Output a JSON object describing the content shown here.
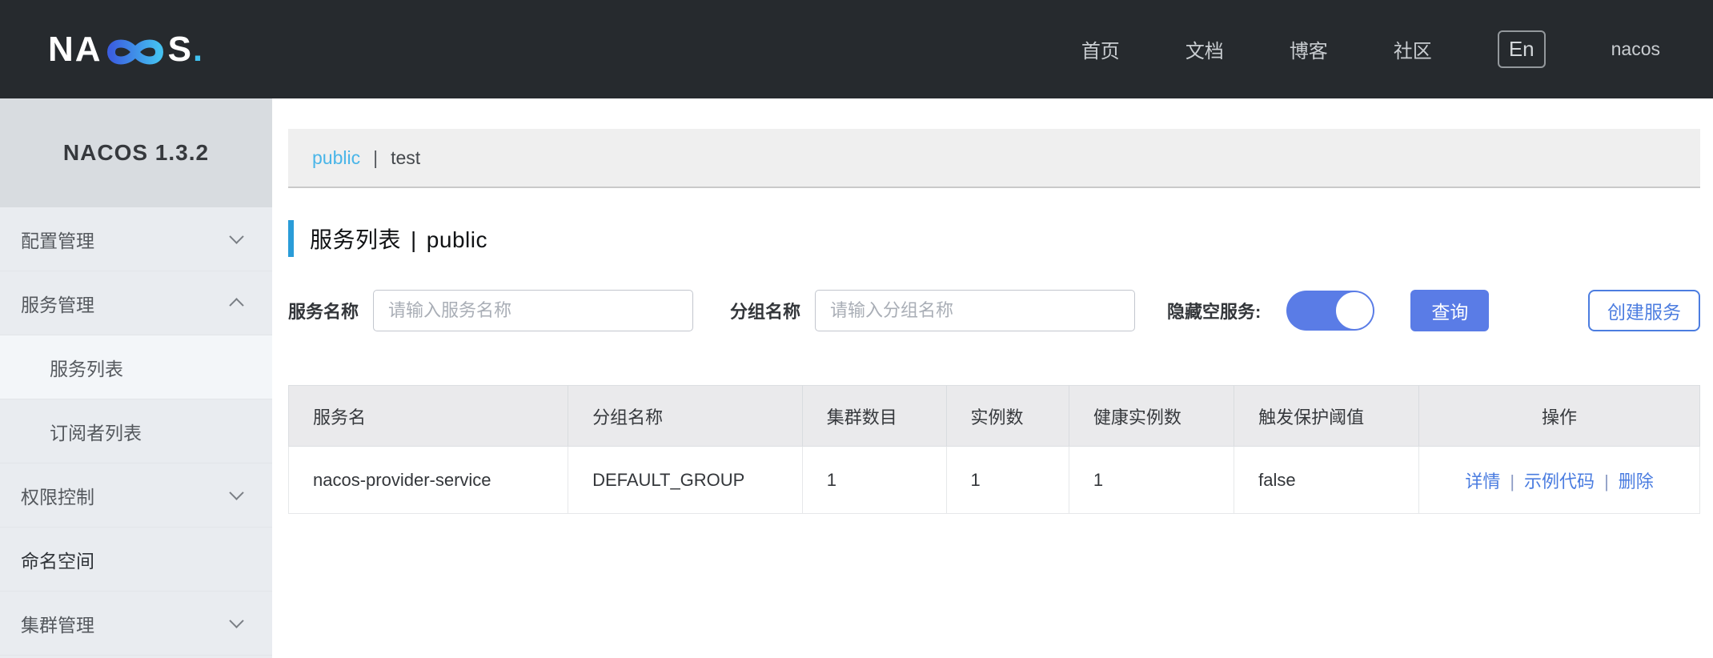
{
  "header": {
    "logo": {
      "prefix": "NA",
      "suffix": "S",
      "dot": "."
    },
    "nav": [
      "首页",
      "文档",
      "博客",
      "社区"
    ],
    "lang": "En",
    "user": "nacos"
  },
  "sidebar": {
    "version": "NACOS 1.3.2",
    "items": [
      {
        "label": "配置管理",
        "chevron": "down"
      },
      {
        "label": "服务管理",
        "chevron": "up"
      },
      {
        "label": "服务列表",
        "sub": true,
        "selected": true
      },
      {
        "label": "订阅者列表",
        "sub": true
      },
      {
        "label": "权限控制",
        "chevron": "down"
      },
      {
        "label": "命名空间"
      },
      {
        "label": "集群管理",
        "chevron": "down"
      }
    ]
  },
  "namespace_bar": {
    "separator": "|",
    "tabs": [
      {
        "label": "public",
        "active": true
      },
      {
        "label": "test",
        "active": false
      }
    ]
  },
  "page": {
    "title": "服务列表",
    "separator": "|",
    "namespace": "public"
  },
  "filters": {
    "service_label": "服务名称",
    "service_placeholder": "请输入服务名称",
    "service_value": "",
    "group_label": "分组名称",
    "group_placeholder": "请输入分组名称",
    "group_value": "",
    "hide_empty_label": "隐藏空服务:",
    "hide_empty_on": true,
    "search_button": "查询",
    "create_button": "创建服务"
  },
  "table": {
    "columns": [
      "服务名",
      "分组名称",
      "集群数目",
      "实例数",
      "健康实例数",
      "触发保护阈值",
      "操作"
    ],
    "action_separator": "|",
    "rows": [
      {
        "service_name": "nacos-provider-service",
        "group": "DEFAULT_GROUP",
        "clusters": "1",
        "instances": "1",
        "healthy": "1",
        "protect_threshold": "false",
        "actions": [
          "详情",
          "示例代码",
          "删除"
        ]
      }
    ]
  },
  "colors": {
    "header_bg": "#262a2e",
    "accent_blue": "#2a9cd8",
    "primary_button": "#5a7ce6",
    "link_blue": "#4a7ce0",
    "namespace_active": "#49b5e8",
    "sidebar_bg": "#e9ecf0",
    "sidebar_header_bg": "#d8dce0",
    "logo_gradient_start": "#3b5fe0",
    "logo_gradient_end": "#44c0f0"
  }
}
